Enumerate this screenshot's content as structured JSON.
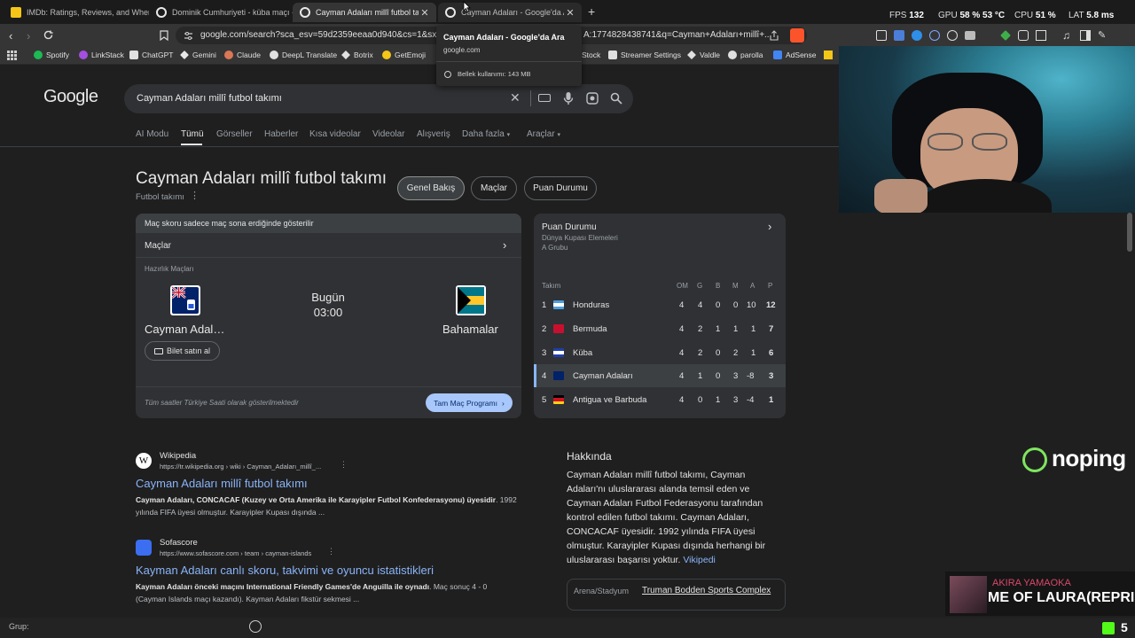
{
  "tabs": [
    {
      "title": "IMDb: Ratings, Reviews, and Where t"
    },
    {
      "title": "Dominik Cumhuriyeti - küba maçı - G"
    },
    {
      "title": "Cayman Adaları millî futbol takımı"
    },
    {
      "title": "Cayman Adaları - Google'da Ara"
    }
  ],
  "hud": {
    "fps_label": "FPS",
    "fps": "132",
    "gpu_label": "GPU",
    "gpu": "58 % 53 °C",
    "cpu_label": "CPU",
    "cpu": "51 %",
    "lat_label": "LAT",
    "lat": "5.8 ms"
  },
  "url": "google.com/search?sca_esv=59d2359eeaa0d940&cs=1&sxsrf=A",
  "url_tail": "A:1774828438741&q=Cayman+Adaları+millî+...",
  "tooltip": {
    "title": "Cayman Adaları - Google'da Ara",
    "domain": "google.com",
    "memory": "Bellek kullanımı: 143 MB"
  },
  "bookmarks": [
    "Spotify",
    "LinkStack",
    "ChatGPT",
    "Gemini",
    "Claude",
    "DeepL Translate",
    "Botrix",
    "GetEmoji",
    "Stock",
    "Streamer Settings",
    "Valdle",
    "parolla",
    "AdSense"
  ],
  "google": {
    "logo": "Google",
    "query": "Cayman Adaları millî futbol takımı",
    "nav": [
      "AI Modu",
      "Tümü",
      "Görseller",
      "Haberler",
      "Kısa videolar",
      "Videolar",
      "Alışveriş",
      "Daha fazla",
      "Araçlar"
    ]
  },
  "entity": {
    "title": "Cayman Adaları millî futbol takımı",
    "subtitle": "Futbol takımı",
    "chips": [
      "Genel Bakış",
      "Maçlar",
      "Puan Durumu"
    ]
  },
  "match_card": {
    "notice": "Maç skoru sadece maç sona erdiğinde gösterilir",
    "matches_label": "Maçlar",
    "category": "Hazırlık Maçları",
    "home": "Cayman Adal…",
    "away": "Bahamalar",
    "day": "Bugün",
    "time": "03:00",
    "ticket": "Bilet satın al",
    "footnote": "Tüm saatler Türkiye Saati olarak gösterilmektedir",
    "schedule_btn": "Tam Maç Programı"
  },
  "standings": {
    "title": "Puan Durumu",
    "subtitle1": "Dünya Kupası Elemeleri",
    "subtitle2": "A Grubu",
    "headers": [
      "Takım",
      "OM",
      "G",
      "B",
      "M",
      "A",
      "P"
    ],
    "rows": [
      {
        "rank": "1",
        "team": "Honduras",
        "om": "4",
        "g": "4",
        "b": "0",
        "m": "0",
        "a": "10",
        "p": "12"
      },
      {
        "rank": "2",
        "team": "Bermuda",
        "om": "4",
        "g": "2",
        "b": "1",
        "m": "1",
        "a": "1",
        "p": "7"
      },
      {
        "rank": "3",
        "team": "Küba",
        "om": "4",
        "g": "2",
        "b": "0",
        "m": "2",
        "a": "1",
        "p": "6"
      },
      {
        "rank": "4",
        "team": "Cayman Adaları",
        "om": "4",
        "g": "1",
        "b": "0",
        "m": "3",
        "a": "-8",
        "p": "3"
      },
      {
        "rank": "5",
        "team": "Antigua ve Barbuda",
        "om": "4",
        "g": "0",
        "b": "1",
        "m": "3",
        "a": "-4",
        "p": "1"
      }
    ]
  },
  "results": [
    {
      "source": "Wikipedia",
      "url": "https://tr.wikipedia.org › wiki › Cayman_Adaları_millî_...",
      "title": "Cayman Adaları millî futbol takımı",
      "snippet_bold": "Cayman Adaları, CONCACAF (Kuzey ve Orta Amerika ile Karayipler Futbol Konfederasyonu) üyesidir",
      "snippet": ". 1992 yılında FIFA üyesi olmuştur. Karayipler Kupası dışında ..."
    },
    {
      "source": "Sofascore",
      "url": "https://www.sofascore.com › team › cayman-islands",
      "title": "Kayman Adaları canlı skoru, takvimi ve oyuncu istatistikleri",
      "snippet_bold": "Kayman Adaları önceki maçını International Friendly Games'de Anguilla ile oynadı",
      "snippet": ". Maç sonuç 4 - 0 (Cayman Islands maçı kazandı). Kayman Adaları fikstür sekmesi ..."
    }
  ],
  "about": {
    "heading": "Hakkında",
    "text": "Cayman Adaları millî futbol takımı, Cayman Adaları'nı uluslararası alanda temsil eden ve Cayman Adaları Futbol Federasyonu tarafından kontrol edilen futbol takımı. Cayman Adaları, CONCACAF üyesidir. 1992 yılında FIFA üyesi olmuştur. Karayipler Kupası dışında herhangi bir uluslararası başarısı yoktur.",
    "link": "Vikipedi",
    "stadium_label": "Arena/Stadyum",
    "stadium": "Truman Bodden Sports Complex"
  },
  "overlay": {
    "brand": "noping",
    "artist": "AKIRA YAMAOKA",
    "song": "ME OF LAURA(REPRIS",
    "group_label": "Grup:",
    "kick_count": "5"
  }
}
